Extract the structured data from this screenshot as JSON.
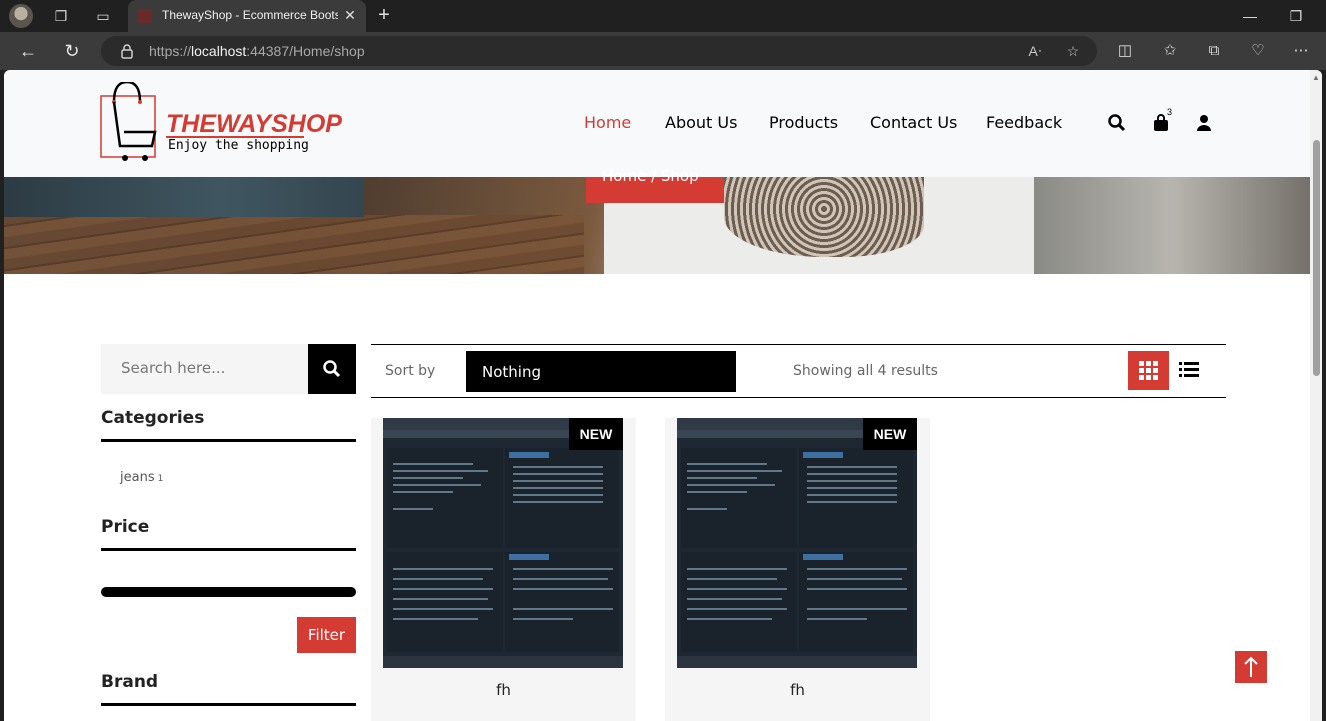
{
  "browser": {
    "tab_title": "ThewayShop - Ecommerce Bootstrap",
    "url_prefix": "https://",
    "url_host": "localhost",
    "url_path": ":44387/Home/shop"
  },
  "header": {
    "logo_name": "THEWAYSHOP",
    "logo_tagline": "Enjoy the shopping",
    "nav": [
      {
        "label": "Home",
        "active": true
      },
      {
        "label": "About Us"
      },
      {
        "label": "Products"
      },
      {
        "label": "Contact Us"
      },
      {
        "label": "Feedback"
      }
    ],
    "cart_count": "3"
  },
  "breadcrumb": {
    "text": "Home  /  Shop"
  },
  "sidebar": {
    "search_placeholder": "Search here...",
    "categories_title": "Categories",
    "categories": [
      {
        "label": "jeans",
        "count": "1"
      }
    ],
    "price_title": "Price",
    "filter_label": "Filter",
    "brand_title": "Brand"
  },
  "toolbar": {
    "sort_label": "Sort by",
    "sort_value": "Nothing",
    "results_text": "Showing all 4 results"
  },
  "products": [
    {
      "name": "fh",
      "badge": "NEW"
    },
    {
      "name": "fh",
      "badge": "NEW"
    }
  ],
  "colors": {
    "accent": "#d33b33",
    "dark": "#000000",
    "light_bg": "#f5f5f5"
  }
}
